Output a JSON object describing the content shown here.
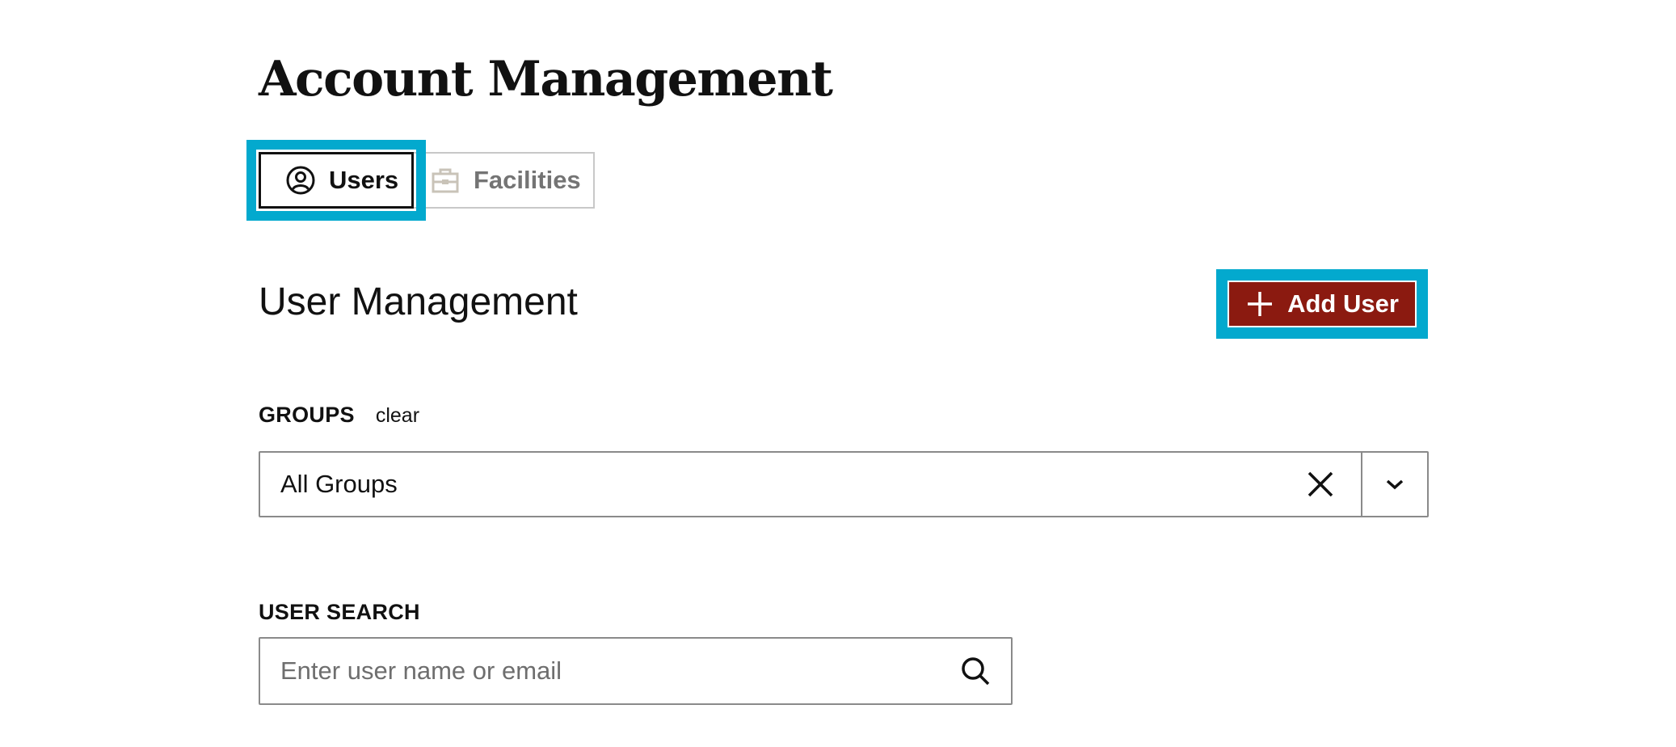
{
  "header": {
    "title": "Account Management"
  },
  "tabs": [
    {
      "label": "Users",
      "icon": "user-circle-icon",
      "active": true
    },
    {
      "label": "Facilities",
      "icon": "briefcase-icon",
      "active": false
    }
  ],
  "section": {
    "title": "User Management",
    "add_button_label": "Add User",
    "add_button_icon": "plus-icon"
  },
  "groups": {
    "label": "GROUPS",
    "clear_label": "clear",
    "selected_value": "All Groups",
    "clear_icon": "close-icon",
    "toggle_icon": "chevron-down-icon"
  },
  "user_search": {
    "label": "USER SEARCH",
    "placeholder": "Enter user name or email",
    "value": "",
    "icon": "search-icon"
  },
  "colors": {
    "accent_highlight": "#03A9CE",
    "primary_button": "#8B1A10",
    "text": "#111111",
    "inactive_text": "#747474"
  }
}
